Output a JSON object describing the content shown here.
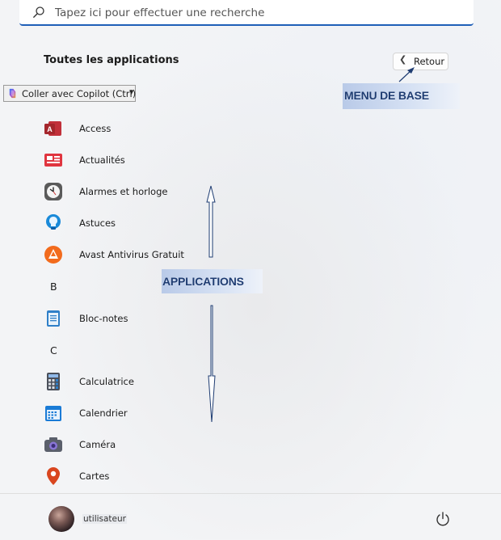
{
  "search": {
    "placeholder": "Tapez ici pour effectuer une recherche",
    "icon": "search-icon"
  },
  "header": {
    "title": "Toutes les applications",
    "back_label": "Retour",
    "back_icon": "chevron-left-icon"
  },
  "copilot": {
    "label": "Coller avec Copilot (Ctrl)",
    "icon": "copilot-icon",
    "dropdown_icon": "caret-down-icon"
  },
  "annotations": {
    "menu": "MENU DE BASE",
    "apps": "APPLICATIONS"
  },
  "apps": [
    {
      "name": "Access",
      "icon": "access-icon"
    },
    {
      "name": "Actualités",
      "icon": "news-icon"
    },
    {
      "name": "Alarmes et horloge",
      "icon": "clock-icon"
    },
    {
      "name": "Astuces",
      "icon": "tips-icon"
    },
    {
      "name": "Avast Antivirus Gratuit",
      "icon": "avast-icon"
    }
  ],
  "letters": [
    "B",
    "C"
  ],
  "apps_b": [
    {
      "name": "Bloc-notes",
      "icon": "notepad-icon"
    }
  ],
  "apps_c": [
    {
      "name": "Calculatrice",
      "icon": "calculator-icon"
    },
    {
      "name": "Calendrier",
      "icon": "calendar-icon"
    },
    {
      "name": "Caméra",
      "icon": "camera-icon"
    },
    {
      "name": "Cartes",
      "icon": "maps-icon"
    }
  ],
  "footer": {
    "user": "utilisateur",
    "power_icon": "power-icon",
    "avatar": "avatar"
  },
  "colors": {
    "accent": "#1f5fb8",
    "annotation_text": "#1e3c72",
    "annotation_bg": "#b9cae8"
  }
}
